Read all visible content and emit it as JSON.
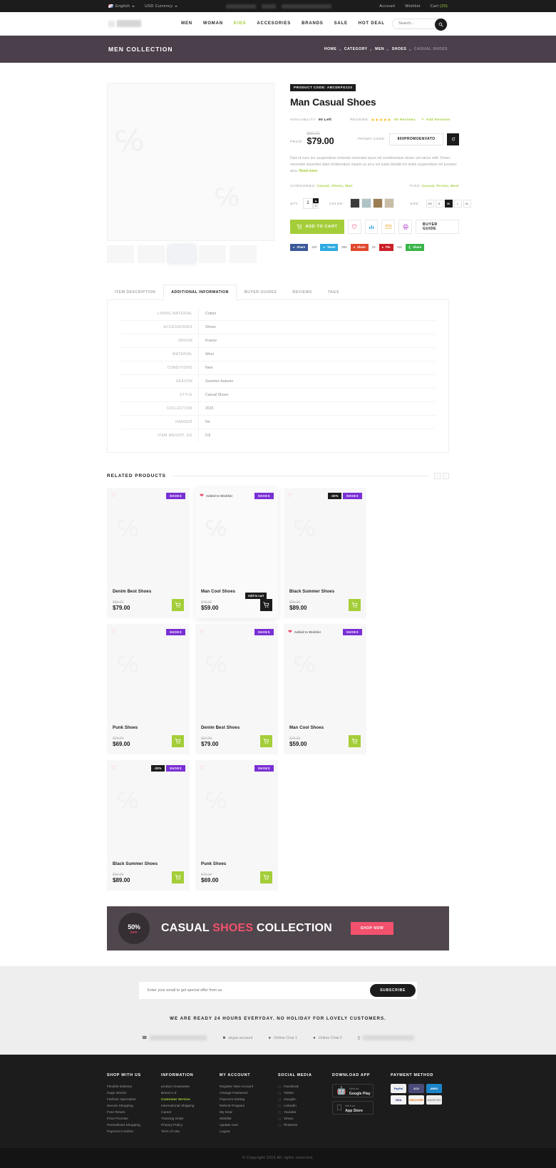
{
  "topbar": {
    "language": "English",
    "currency": "USD Currency",
    "account": "Account",
    "wishlist": "Wishlist",
    "cart_label": "Cart",
    "cart_count": "(20)"
  },
  "header": {
    "nav": [
      {
        "label": "MEN",
        "active": false
      },
      {
        "label": "WOMAN",
        "active": false
      },
      {
        "label": "KIDS",
        "active": true
      },
      {
        "label": "ACCESORIES",
        "active": false
      },
      {
        "label": "BRANDS",
        "active": false
      },
      {
        "label": "SALE",
        "active": false
      },
      {
        "label": "HOT DEAL",
        "active": false
      }
    ],
    "search_placeholder": "Search..."
  },
  "banner": {
    "title": "MEN COLLECTION",
    "breadcrumb": [
      "HOME",
      "CATEGORY",
      "MEN",
      "SHOES",
      "CASUAL SHOES"
    ]
  },
  "product": {
    "code_label": "PRODUCT CODE:",
    "code_value": "ABCDEFG123",
    "title": "Man Casual Shoes",
    "availability_label": "AVAILABILITY:",
    "availability_value": "90 Left",
    "reviews_label": "REVIEWS",
    "stars": "★★★★★",
    "reviews_count": "90 Reviews",
    "add_reviews": "Add Reviews",
    "price_label": "PRICE:",
    "old_price": "$89.00",
    "new_price": "$79.00",
    "promo_label": "PROMO CODE:",
    "promo_value": "800PROMOENVATO",
    "description": "Duis id nunc leo suspendisse molestie venenatis lacus vel condimentum donec vel varius velit. Donec venenatis imperdiet diam id bibendum mauris ac arcu vel turpis blandit mo lestie suspendisse vel posuere arcu.",
    "read_more": "Read more",
    "categories_label": "CATEGORIES:",
    "categories_value": "Casual, Shoes, Man",
    "tags_label": "TAGS:",
    "tags_value": "Casual, Promo, Best",
    "qty_label": "QTY:",
    "qty_value": "2",
    "color_label": "COLOR:",
    "colors": [
      "#3a3a3a",
      "#aec4c7",
      "#9a7d53",
      "#c9bda8"
    ],
    "size_label": "SIZE:",
    "sizes": [
      "XS",
      "S",
      "M",
      "L",
      "XL"
    ],
    "size_selected": "M",
    "add_to_cart": "ADD TO CART",
    "buyer_guide": "BUYER GUIDE",
    "shares": [
      {
        "network": "Share",
        "count": "150",
        "color": "#3b5998",
        "icon": "f"
      },
      {
        "network": "Tweet",
        "count": "856",
        "color": "#2eaae1",
        "icon": "t"
      },
      {
        "network": "Share",
        "count": "25",
        "color": "#e0492e",
        "icon": "g"
      },
      {
        "network": "Pin",
        "count": "15k",
        "color": "#cb2027",
        "icon": "p"
      },
      {
        "network": "Share",
        "count": "",
        "color": "#3ab54a",
        "icon": "s"
      }
    ]
  },
  "tabs": {
    "items": [
      "ITEM DESCRIPTION",
      "ADDITIONAL INFORMATION",
      "BUYER GUIDES",
      "REVIEWS",
      "TAGS"
    ],
    "active": "ADDITIONAL INFORMATION"
  },
  "specs": [
    {
      "key": "LINING MATERIAL",
      "value": "Cotton"
    },
    {
      "key": "ACCESSORIES",
      "value": "Shoes"
    },
    {
      "key": "ORIGIN",
      "value": "France"
    },
    {
      "key": "MATERIAL",
      "value": "Wool"
    },
    {
      "key": "CONDITIONS",
      "value": "New"
    },
    {
      "key": "SEASON",
      "value": "Summer-Autumn"
    },
    {
      "key": "STYLE",
      "value": "Casual Shoes"
    },
    {
      "key": "COLLECTION",
      "value": "2015"
    },
    {
      "key": "HANGER",
      "value": "No"
    },
    {
      "key": "ITEM WEIGHT, KG",
      "value": "0.8"
    }
  ],
  "related": {
    "title": "RELATED PRODUCTS",
    "products": [
      {
        "name": "Denim Best Shoes",
        "old_price": "$89.00",
        "price": "$79.00",
        "category": "SHOES",
        "sale": "",
        "wishlisted": false,
        "wish_text": "",
        "hovered": false,
        "tooltip": ""
      },
      {
        "name": "Man Cool Shoes",
        "old_price": "$79.00",
        "price": "$59.00",
        "category": "SHOES",
        "sale": "",
        "wishlisted": true,
        "wish_text": "Added to Wishlist",
        "hovered": true,
        "tooltip": "Add to cart"
      },
      {
        "name": "Black Summer Shoes",
        "old_price": "$99.00",
        "price": "$89.00",
        "category": "SHOES",
        "sale": "-30%",
        "wishlisted": false,
        "wish_text": "",
        "hovered": false,
        "tooltip": ""
      },
      {
        "name": "Punk Shoes",
        "old_price": "$79.00",
        "price": "$69.00",
        "category": "SHOES",
        "sale": "",
        "wishlisted": false,
        "wish_text": "",
        "hovered": false,
        "tooltip": ""
      },
      {
        "name": "Denim Best Shoes",
        "old_price": "$89.00",
        "price": "$79.00",
        "category": "SHOES",
        "sale": "",
        "wishlisted": false,
        "wish_text": "",
        "hovered": false,
        "tooltip": ""
      },
      {
        "name": "Man Cool Shoes",
        "old_price": "$79.00",
        "price": "$59.00",
        "category": "SHOES",
        "sale": "",
        "wishlisted": true,
        "wish_text": "Added to Wishlist",
        "hovered": false,
        "tooltip": ""
      },
      {
        "name": "Black Summer Shoes",
        "old_price": "$99.00",
        "price": "$89.00",
        "category": "SHOES",
        "sale": "-30%",
        "wishlisted": false,
        "wish_text": "",
        "hovered": false,
        "tooltip": ""
      },
      {
        "name": "Punk Shoes",
        "old_price": "$79.00",
        "price": "$69.00",
        "category": "SHOES",
        "sale": "",
        "wishlisted": false,
        "wish_text": "",
        "hovered": false,
        "tooltip": ""
      }
    ]
  },
  "promo_banner": {
    "percent": "50%",
    "off": "OFF",
    "text_1": "CASUAL ",
    "text_hl": "SHOES",
    "text_2": " COLLECTION",
    "button": "SHOP NOW"
  },
  "newsletter": {
    "placeholder": "Enter your email to get special offer from us.",
    "button": "SUBSCRIBE",
    "ready_text": "WE ARE READY 24 HOURS EVERYDAY. NO HOLIDAY FOR LOVELY CUSTOMERS.",
    "contacts": [
      {
        "icon": "phone-icon",
        "text": "",
        "redacted": true,
        "width": 80
      },
      {
        "icon": "skype-icon",
        "text": "skype.account",
        "redacted": false,
        "width": 0
      },
      {
        "icon": "chat-icon",
        "text": "Online Chat 1",
        "redacted": false,
        "width": 0
      },
      {
        "icon": "chat-icon",
        "text": "Online Chat 2",
        "redacted": false,
        "width": 0
      },
      {
        "icon": "mobile-icon",
        "text": "",
        "redacted": true,
        "width": 72
      }
    ]
  },
  "footer": {
    "columns": [
      {
        "heading": "SHOP WITH US",
        "links": [
          "Flexible Delivery",
          "Huge Stocks",
          "Fashion Specialest",
          "Secure Shopping",
          "Free Return",
          "Price Promise",
          "Personlised Shopping",
          "Payment Confirm"
        ],
        "highlight": ""
      },
      {
        "heading": "INFORMATION",
        "links": [
          "product Guarantee",
          "Brand A-Z",
          "Customer Service",
          "International Shipping",
          "Career",
          "Tracking Order",
          "Privacy Policy",
          "Term of Use"
        ],
        "highlight": "Customer Service"
      },
      {
        "heading": "MY ACCOUNT",
        "links": [
          "Register New Account",
          "Change Password",
          "Payment Setting",
          "Referal Program",
          "My Deal",
          "Wishlist",
          "Update Cart",
          "Logout"
        ],
        "highlight": ""
      }
    ],
    "social": {
      "heading": "SOCIAL MEDIA",
      "links": [
        "Facebook",
        "Twitter",
        "Google+",
        "Linkedin",
        "Youtube",
        "Vimeo",
        "Pinterest"
      ]
    },
    "download": {
      "heading": "DOWNLOAD APP",
      "buttons": [
        {
          "small": "Get it on",
          "big": "Google Play",
          "icon": "android-icon"
        },
        {
          "small": "Get it on",
          "big": "App Store",
          "icon": "apple-icon"
        }
      ]
    },
    "payment": {
      "heading": "PAYMENT METHOD",
      "methods": [
        {
          "name": "PayPal",
          "bg": "#f0f0f0",
          "fg": "#1c3f94"
        },
        {
          "name": "2CO",
          "bg": "#4a4a78",
          "fg": "#ffffff"
        },
        {
          "name": "AMEX",
          "bg": "#1b84c7",
          "fg": "#ffffff"
        },
        {
          "name": "VISA",
          "bg": "#f4f4f4",
          "fg": "#1a1f71"
        },
        {
          "name": "DISCOVER",
          "bg": "#f4f4f4",
          "fg": "#e8710a"
        },
        {
          "name": "MAESTRO",
          "bg": "#ededed",
          "fg": "#8a8a8a"
        }
      ]
    },
    "copyright": "© Copyright 2015 All rights reserved."
  }
}
